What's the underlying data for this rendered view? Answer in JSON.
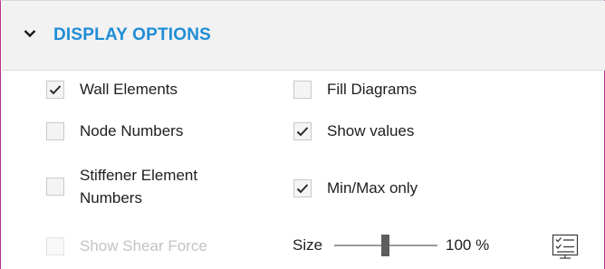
{
  "section": {
    "title": "DISPLAY OPTIONS",
    "expanded": true,
    "accent_color": "#1f8dd6"
  },
  "options": [
    {
      "label": "Wall Elements",
      "checked": true,
      "enabled": true
    },
    {
      "label": "Node Numbers",
      "checked": false,
      "enabled": true
    },
    {
      "label": "Stiffener Element Numbers",
      "checked": false,
      "enabled": true
    },
    {
      "label": "Show Shear Force",
      "checked": false,
      "enabled": false
    },
    {
      "label": "Fill Diagrams",
      "checked": false,
      "enabled": true
    },
    {
      "label": "Show values",
      "checked": true,
      "enabled": true
    },
    {
      "label": "Min/Max only",
      "checked": true,
      "enabled": true
    }
  ],
  "size": {
    "label": "Size",
    "value_text": "100 %",
    "value": 100
  },
  "icons": {
    "collapse": "chevron-down-icon",
    "legend": "legend-list-icon"
  }
}
